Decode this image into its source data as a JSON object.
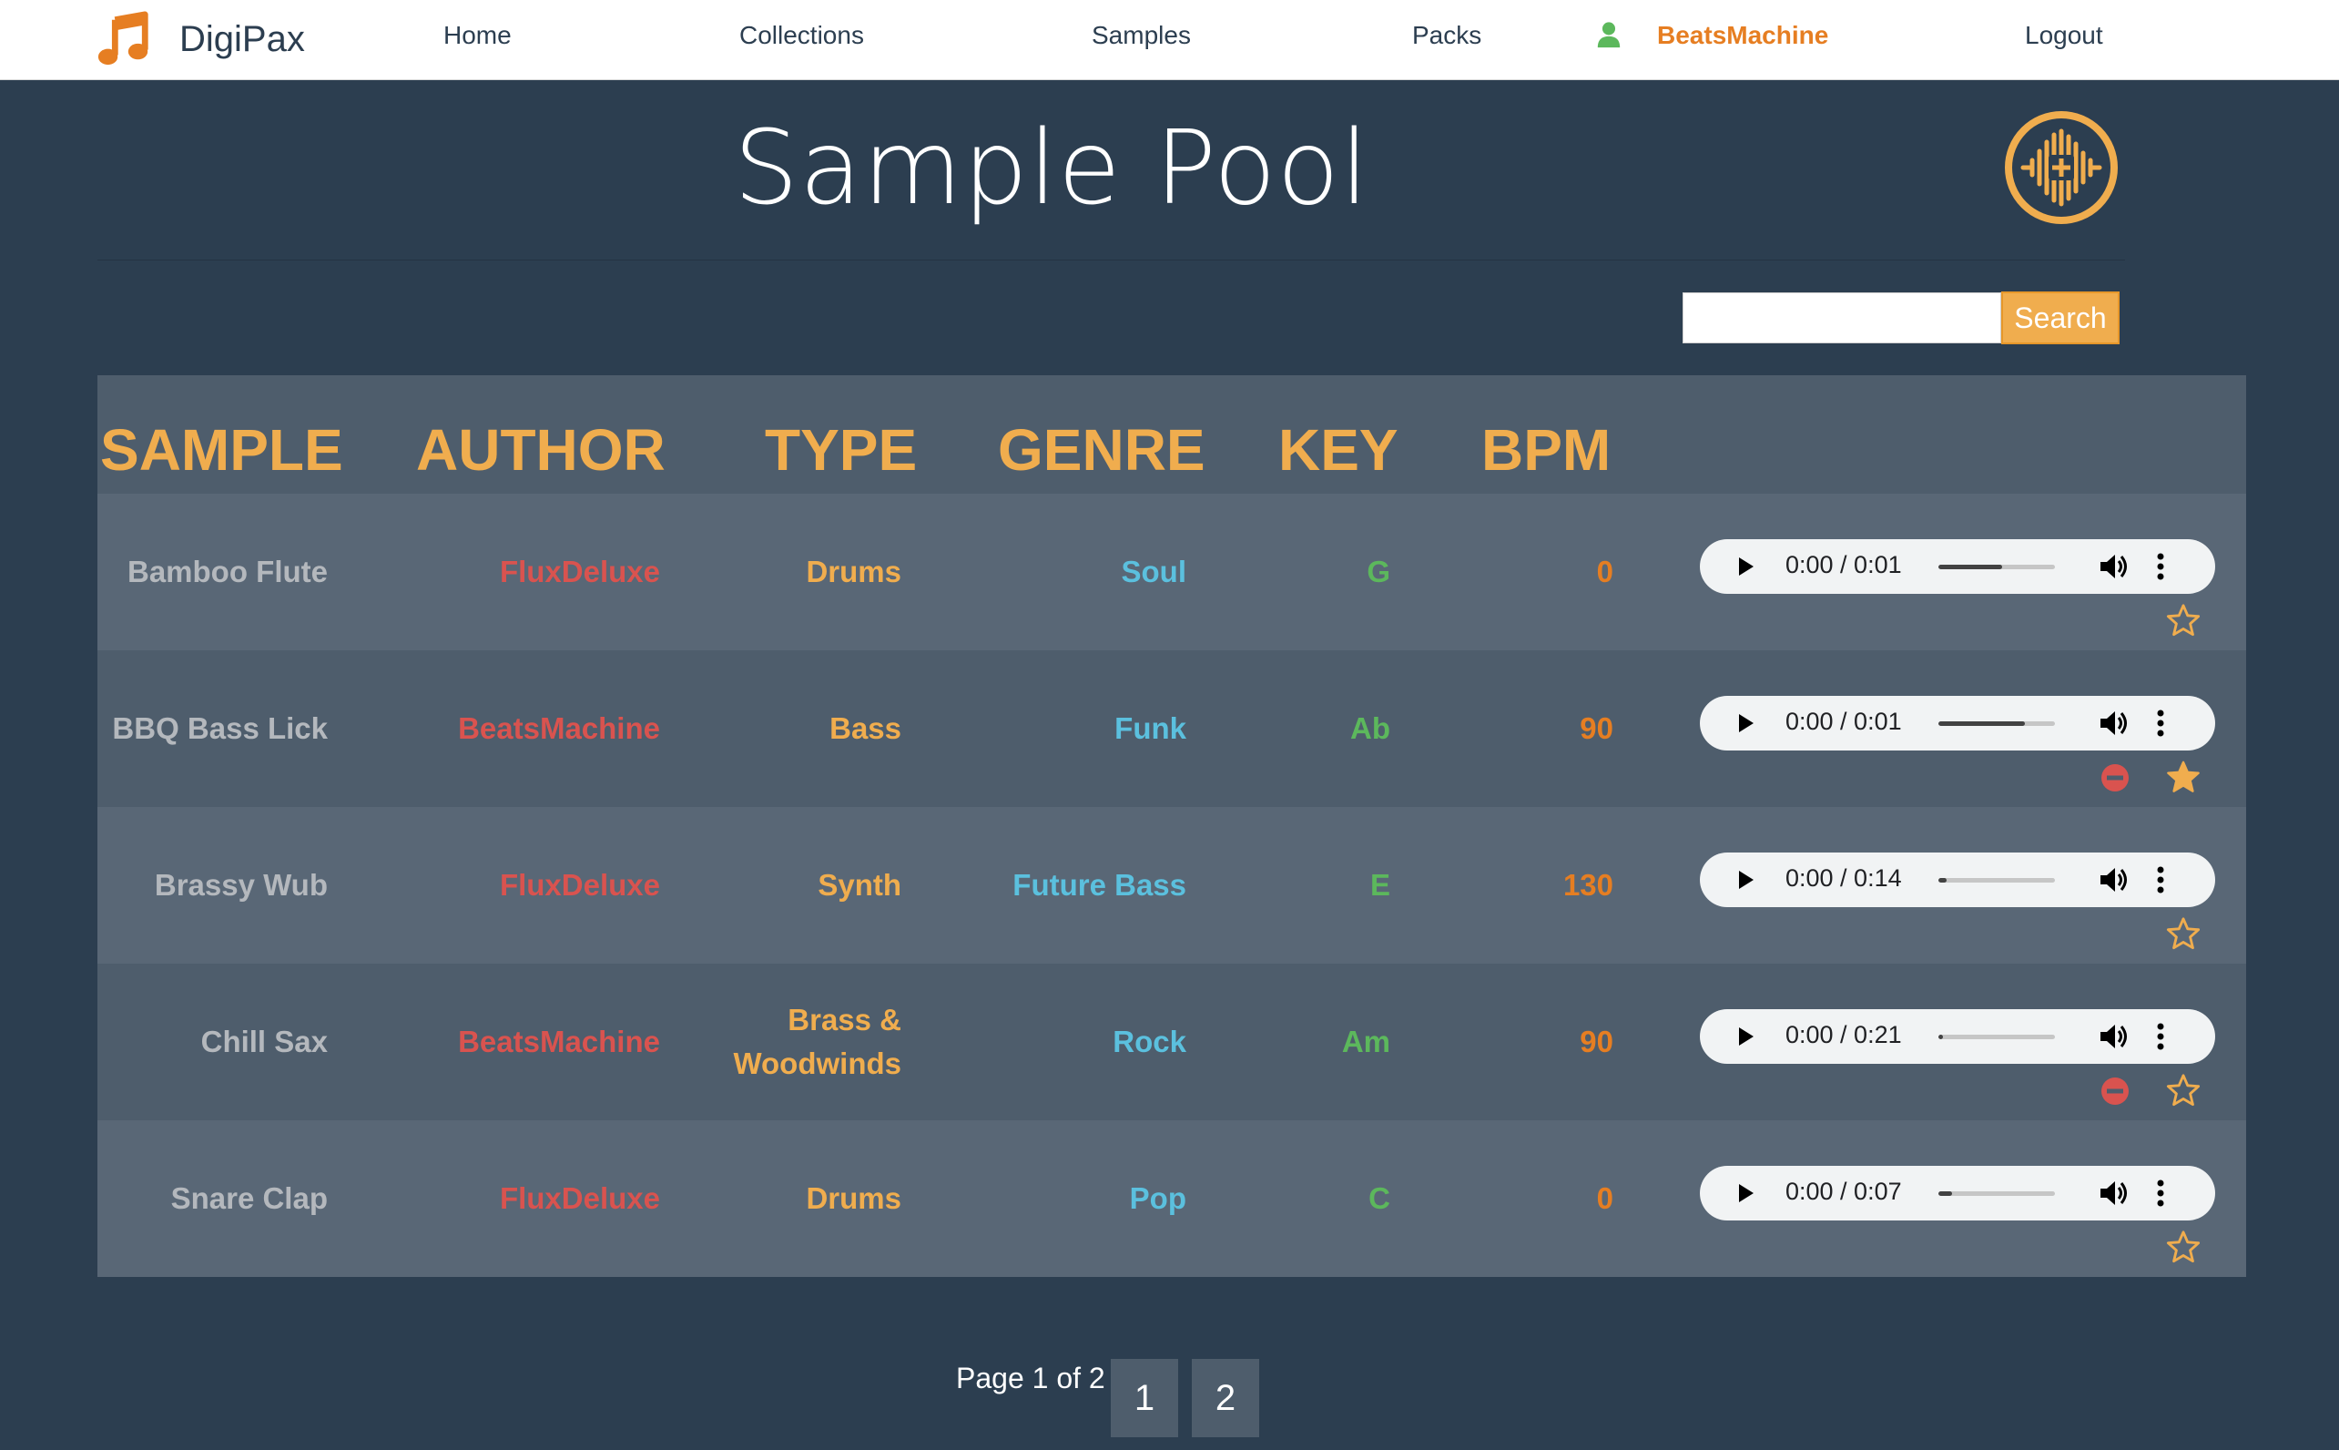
{
  "navbar": {
    "brand": "DigiPax",
    "links": {
      "home": "Home",
      "collections": "Collections",
      "samples": "Samples",
      "packs": "Packs",
      "user": "BeatsMachine",
      "logout": "Logout"
    }
  },
  "page": {
    "title": "Sample Pool"
  },
  "search": {
    "placeholder": "",
    "button": "Search"
  },
  "table": {
    "headers": {
      "sample": "SAMPLE",
      "author": "AUTHOR",
      "type": "TYPE",
      "genre": "GENRE",
      "key": "KEY",
      "bpm": "BPM"
    },
    "rows": [
      {
        "sample": "Bamboo Flute",
        "author": "FluxDeluxe",
        "type_line1": "Drums",
        "type_line2": "",
        "genre": "Soul",
        "key": "G",
        "bpm": "0",
        "time": "0:00 / 0:01",
        "progress": 0.55,
        "can_remove": false,
        "favorited": false
      },
      {
        "sample": "BBQ Bass Lick",
        "author": "BeatsMachine",
        "type_line1": "Bass",
        "type_line2": "",
        "genre": "Funk",
        "key": "Ab",
        "bpm": "90",
        "time": "0:00 / 0:01",
        "progress": 0.74,
        "can_remove": true,
        "favorited": true
      },
      {
        "sample": "Brassy Wub",
        "author": "FluxDeluxe",
        "type_line1": "Synth",
        "type_line2": "",
        "genre": "Future Bass",
        "key": "E",
        "bpm": "130",
        "time": "0:00 / 0:14",
        "progress": 0.07,
        "can_remove": false,
        "favorited": false
      },
      {
        "sample": "Chill Sax",
        "author": "BeatsMachine",
        "type_line1": "Brass &",
        "type_line2": "Woodwinds",
        "genre": "Rock",
        "key": "Am",
        "bpm": "90",
        "time": "0:00 / 0:21",
        "progress": 0.04,
        "can_remove": true,
        "favorited": false
      },
      {
        "sample": "Snare Clap",
        "author": "FluxDeluxe",
        "type_line1": "Drums",
        "type_line2": "",
        "genre": "Pop",
        "key": "C",
        "bpm": "0",
        "time": "0:00 / 0:07",
        "progress": 0.12,
        "can_remove": false,
        "favorited": false
      }
    ]
  },
  "pagination": {
    "info": "Page 1 of 2",
    "pages": [
      "1",
      "2"
    ]
  },
  "colors": {
    "background": "#2c3e50",
    "accent": "#f0ad4e",
    "brand_orange": "#e67e22",
    "author_red": "#d9534f",
    "genre_blue": "#5bc0de",
    "key_green": "#5cb85c"
  },
  "icons": {
    "brand": "music-note-icon",
    "user": "user-icon",
    "add_sample": "add-sample-waveform-icon",
    "play": "play-icon",
    "volume": "volume-icon",
    "more": "more-vertical-icon",
    "remove": "remove-circle-icon",
    "favorite": "star-icon"
  }
}
